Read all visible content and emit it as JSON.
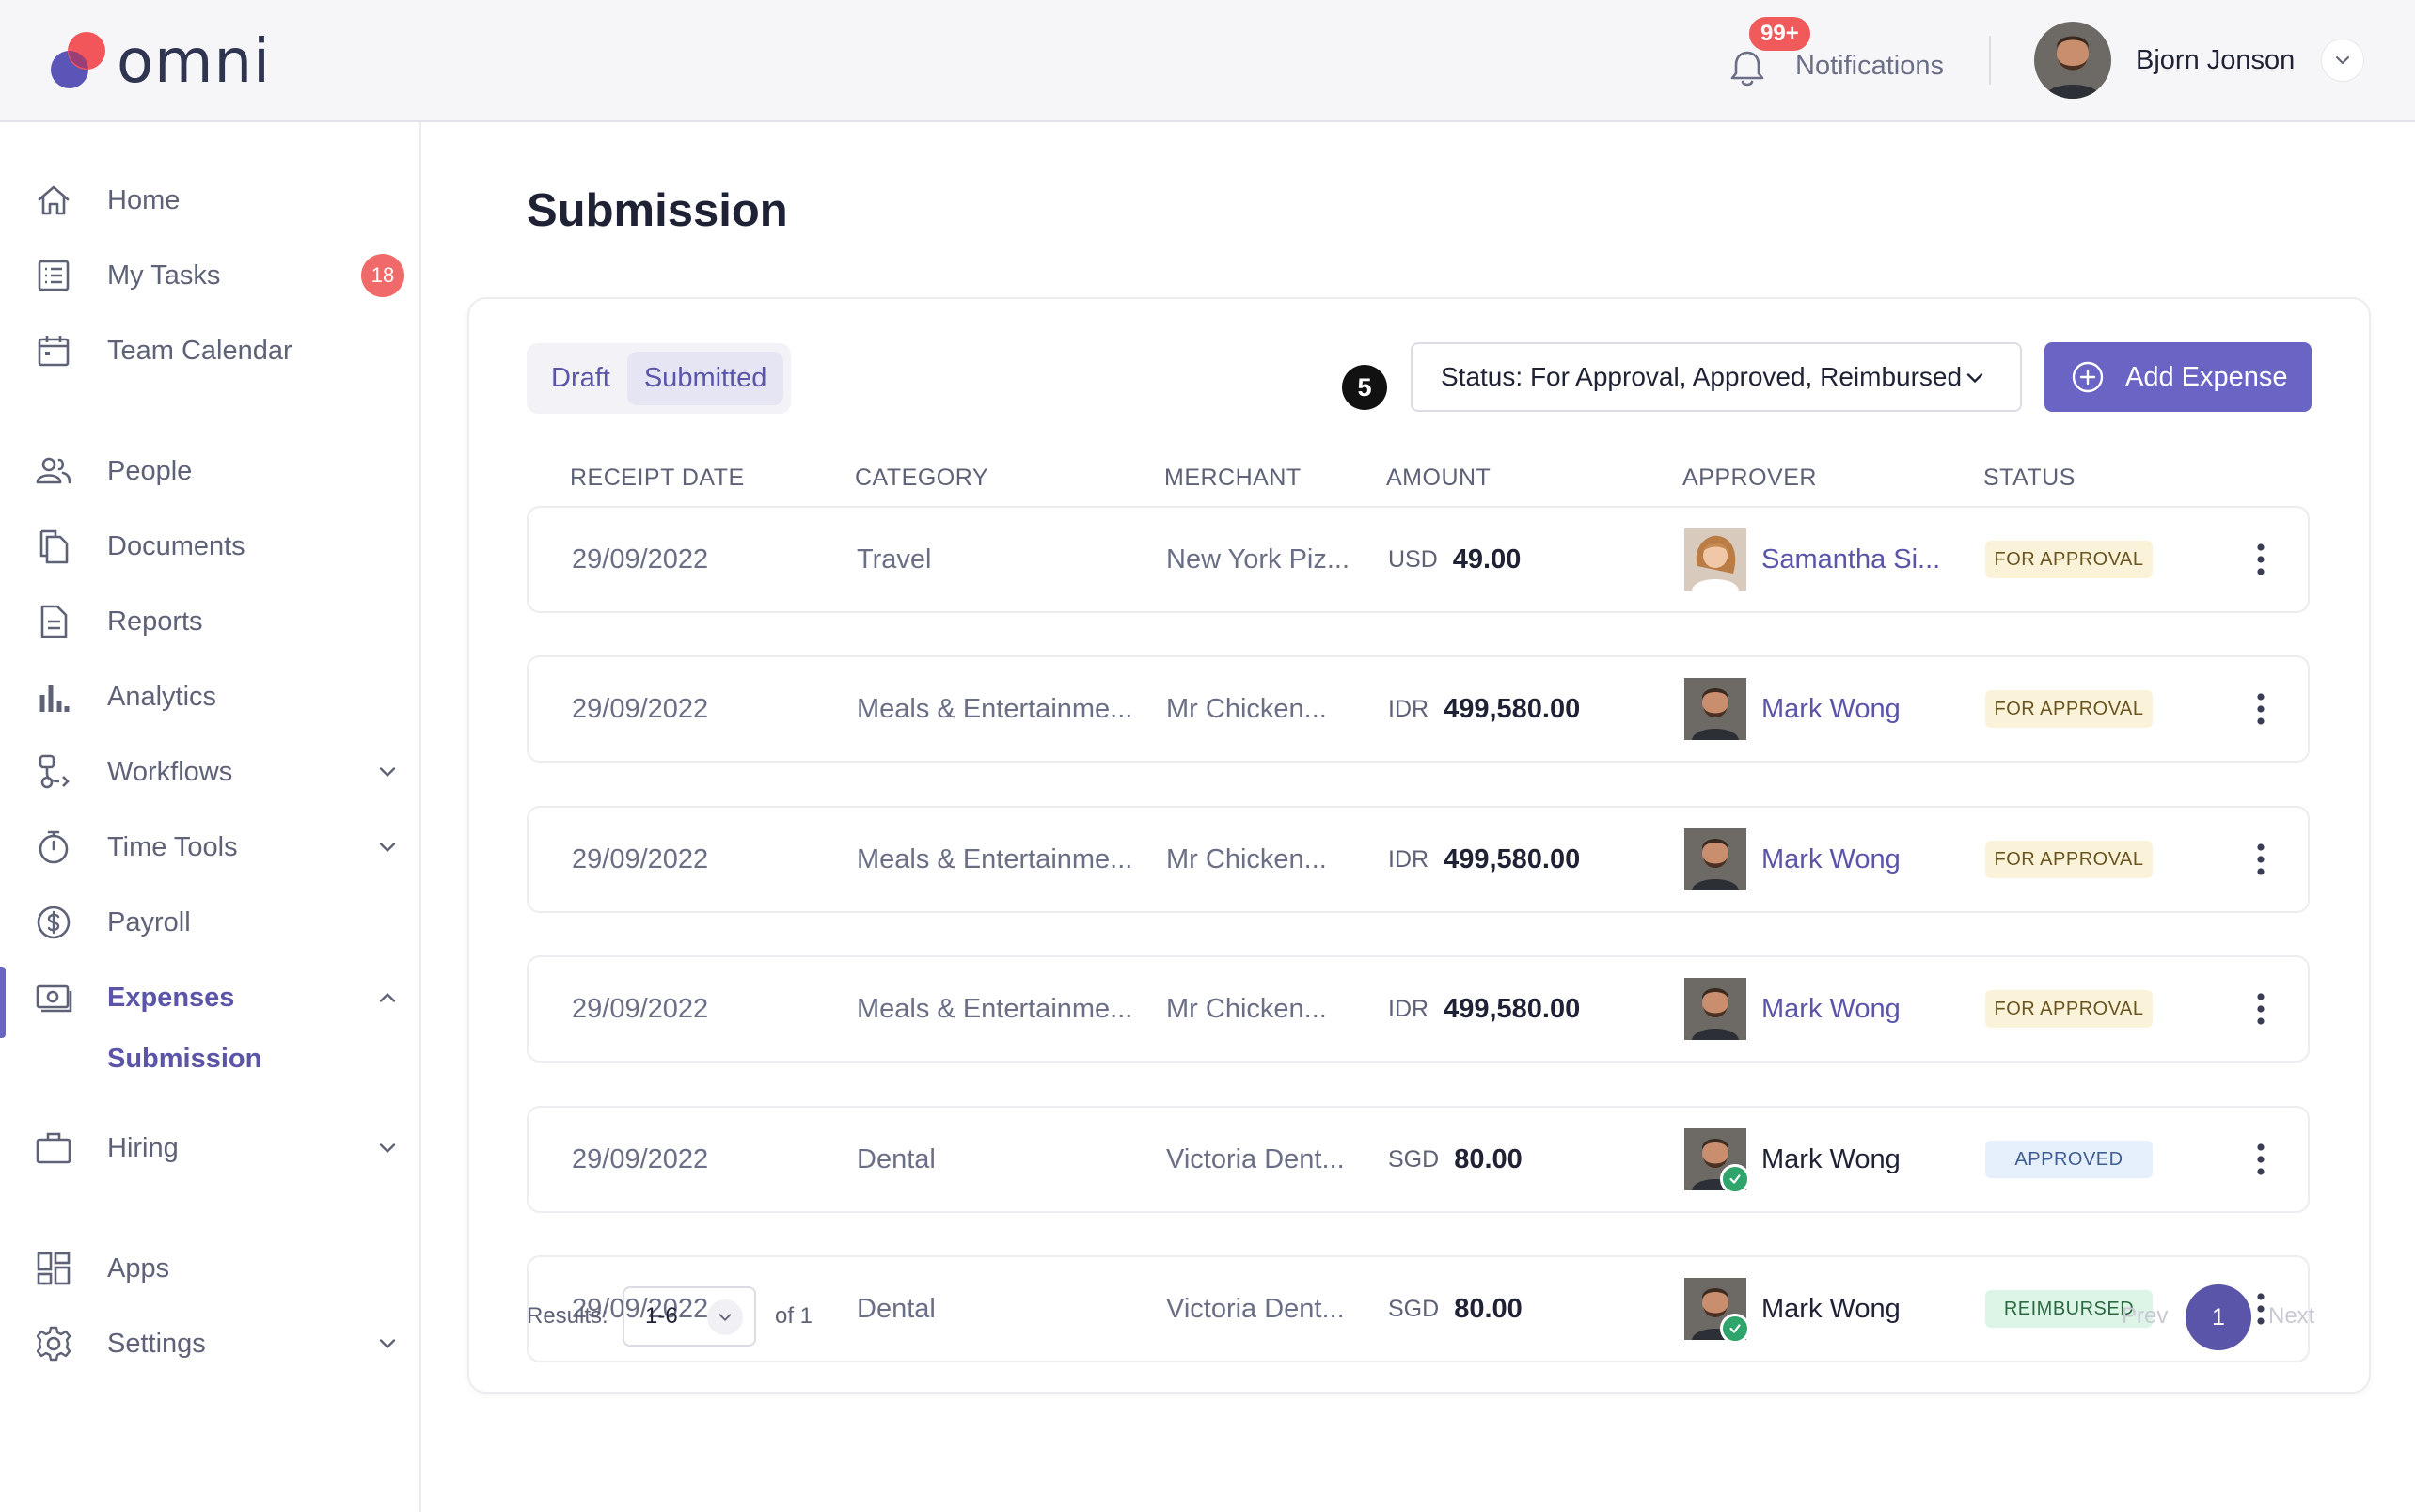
{
  "brand": {
    "name": "omni",
    "colors": {
      "accent": "#6a64c4",
      "logo_red": "#f2555a",
      "logo_purple": "#5b55b8"
    }
  },
  "header": {
    "notifications_label": "Notifications",
    "notifications_badge": "99+",
    "user_name": "Bjorn Jonson"
  },
  "sidebar": {
    "items": [
      {
        "label": "Home",
        "icon": "home-icon"
      },
      {
        "label": "My Tasks",
        "icon": "tasks-icon",
        "badge": "18"
      },
      {
        "label": "Team Calendar",
        "icon": "calendar-icon"
      },
      {
        "label": "People",
        "icon": "people-icon"
      },
      {
        "label": "Documents",
        "icon": "documents-icon"
      },
      {
        "label": "Reports",
        "icon": "reports-icon"
      },
      {
        "label": "Analytics",
        "icon": "analytics-icon"
      },
      {
        "label": "Workflows",
        "icon": "workflows-icon"
      },
      {
        "label": "Time Tools",
        "icon": "timer-icon"
      },
      {
        "label": "Payroll",
        "icon": "dollar-icon"
      },
      {
        "label": "Expenses",
        "icon": "expenses-icon",
        "expanded": true
      },
      {
        "label": "Submission",
        "sub": true
      },
      {
        "label": "Hiring",
        "icon": "briefcase-icon"
      },
      {
        "label": "Apps",
        "icon": "apps-icon"
      },
      {
        "label": "Settings",
        "icon": "gear-icon"
      }
    ]
  },
  "main": {
    "title": "Submission",
    "tabs": [
      {
        "label": "Draft"
      },
      {
        "label": "Submitted",
        "selected": true
      }
    ],
    "step_marker": "5",
    "status_filter": "Status: For Approval, Approved, Reimbursed",
    "add_button": "Add Expense",
    "columns": [
      "RECEIPT DATE",
      "CATEGORY",
      "MERCHANT",
      "AMOUNT",
      "APPROVER",
      "STATUS"
    ],
    "rows": [
      {
        "date": "29/09/2022",
        "category": "Travel",
        "merchant": "New York Piz...",
        "currency": "USD",
        "amount": "49.00",
        "approver": "Samantha Si...",
        "approver_avatar": "female",
        "approved_check": false,
        "status": "FOR APPROVAL",
        "status_type": "pending"
      },
      {
        "date": "29/09/2022",
        "category": "Meals & Entertainme...",
        "merchant": "Mr Chicken...",
        "currency": "IDR",
        "amount": "499,580.00",
        "approver": "Mark Wong",
        "approver_avatar": "male",
        "approved_check": false,
        "status": "FOR APPROVAL",
        "status_type": "pending"
      },
      {
        "date": "29/09/2022",
        "category": "Meals & Entertainme...",
        "merchant": "Mr Chicken...",
        "currency": "IDR",
        "amount": "499,580.00",
        "approver": "Mark Wong",
        "approver_avatar": "male",
        "approved_check": false,
        "status": "FOR APPROVAL",
        "status_type": "pending"
      },
      {
        "date": "29/09/2022",
        "category": "Meals & Entertainme...",
        "merchant": "Mr Chicken...",
        "currency": "IDR",
        "amount": "499,580.00",
        "approver": "Mark Wong",
        "approver_avatar": "male",
        "approved_check": false,
        "status": "FOR APPROVAL",
        "status_type": "pending"
      },
      {
        "date": "29/09/2022",
        "category": "Dental",
        "merchant": "Victoria Dent...",
        "currency": "SGD",
        "amount": "80.00",
        "approver": "Mark Wong",
        "approver_avatar": "male",
        "approved_check": true,
        "status": "APPROVED",
        "status_type": "approved"
      },
      {
        "date": "29/09/2022",
        "category": "Dental",
        "merchant": "Victoria Dent...",
        "currency": "SGD",
        "amount": "80.00",
        "approver": "Mark Wong",
        "approver_avatar": "male",
        "approved_check": true,
        "status": "REIMBURSED",
        "status_type": "reimbursed"
      }
    ],
    "status_colors": {
      "pending": {
        "bg": "#fbf3d9",
        "fg": "#6a5420"
      },
      "approved": {
        "bg": "#e6effc",
        "fg": "#3f5e93"
      },
      "reimbursed": {
        "bg": "#ddf5e6",
        "fg": "#2d6a44"
      }
    }
  },
  "footer": {
    "results_label": "Results:",
    "results_value": "1-6",
    "of_label": "of 1",
    "prev": "Prev",
    "page": "1",
    "next": "Next"
  }
}
